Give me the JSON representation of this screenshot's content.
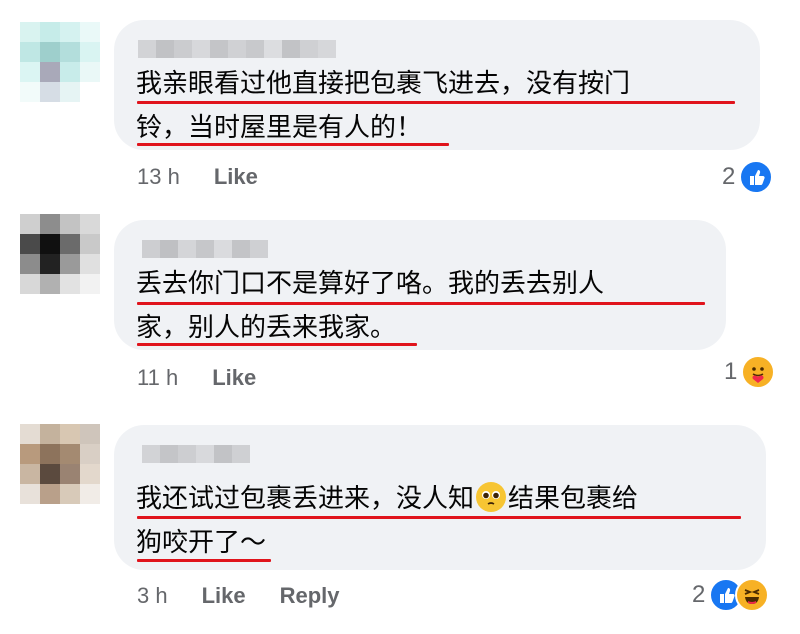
{
  "comments": [
    {
      "text": "我亲眼看过他直接把包裹飞进去，没有按门\n铃，当时屋里是有人的！",
      "time": "13 h",
      "like_label": "Like",
      "reaction_count": "2",
      "reactions": [
        "like-icon"
      ]
    },
    {
      "text": "丢去你门口不是算好了咯。我的丢去别人\n家，别人的丢来我家。",
      "time": "11 h",
      "like_label": "Like",
      "reaction_count": "1",
      "reactions": [
        "care-icon"
      ]
    },
    {
      "text_part1": "我还试过包裹丢进来，没人知",
      "emoji": "pleading-face-emoji",
      "text_part2": "结果包裹给\n狗咬开了～",
      "time": "3 h",
      "like_label": "Like",
      "reply_label": "Reply",
      "reaction_count": "2",
      "reactions": [
        "like-icon",
        "haha-icon"
      ]
    }
  ],
  "colors": {
    "bubble": "#f0f2f5",
    "underline": "#e0141c",
    "meta": "#65676b",
    "like_blue": "#1877f2",
    "reaction_yellow": "#f7b125"
  }
}
